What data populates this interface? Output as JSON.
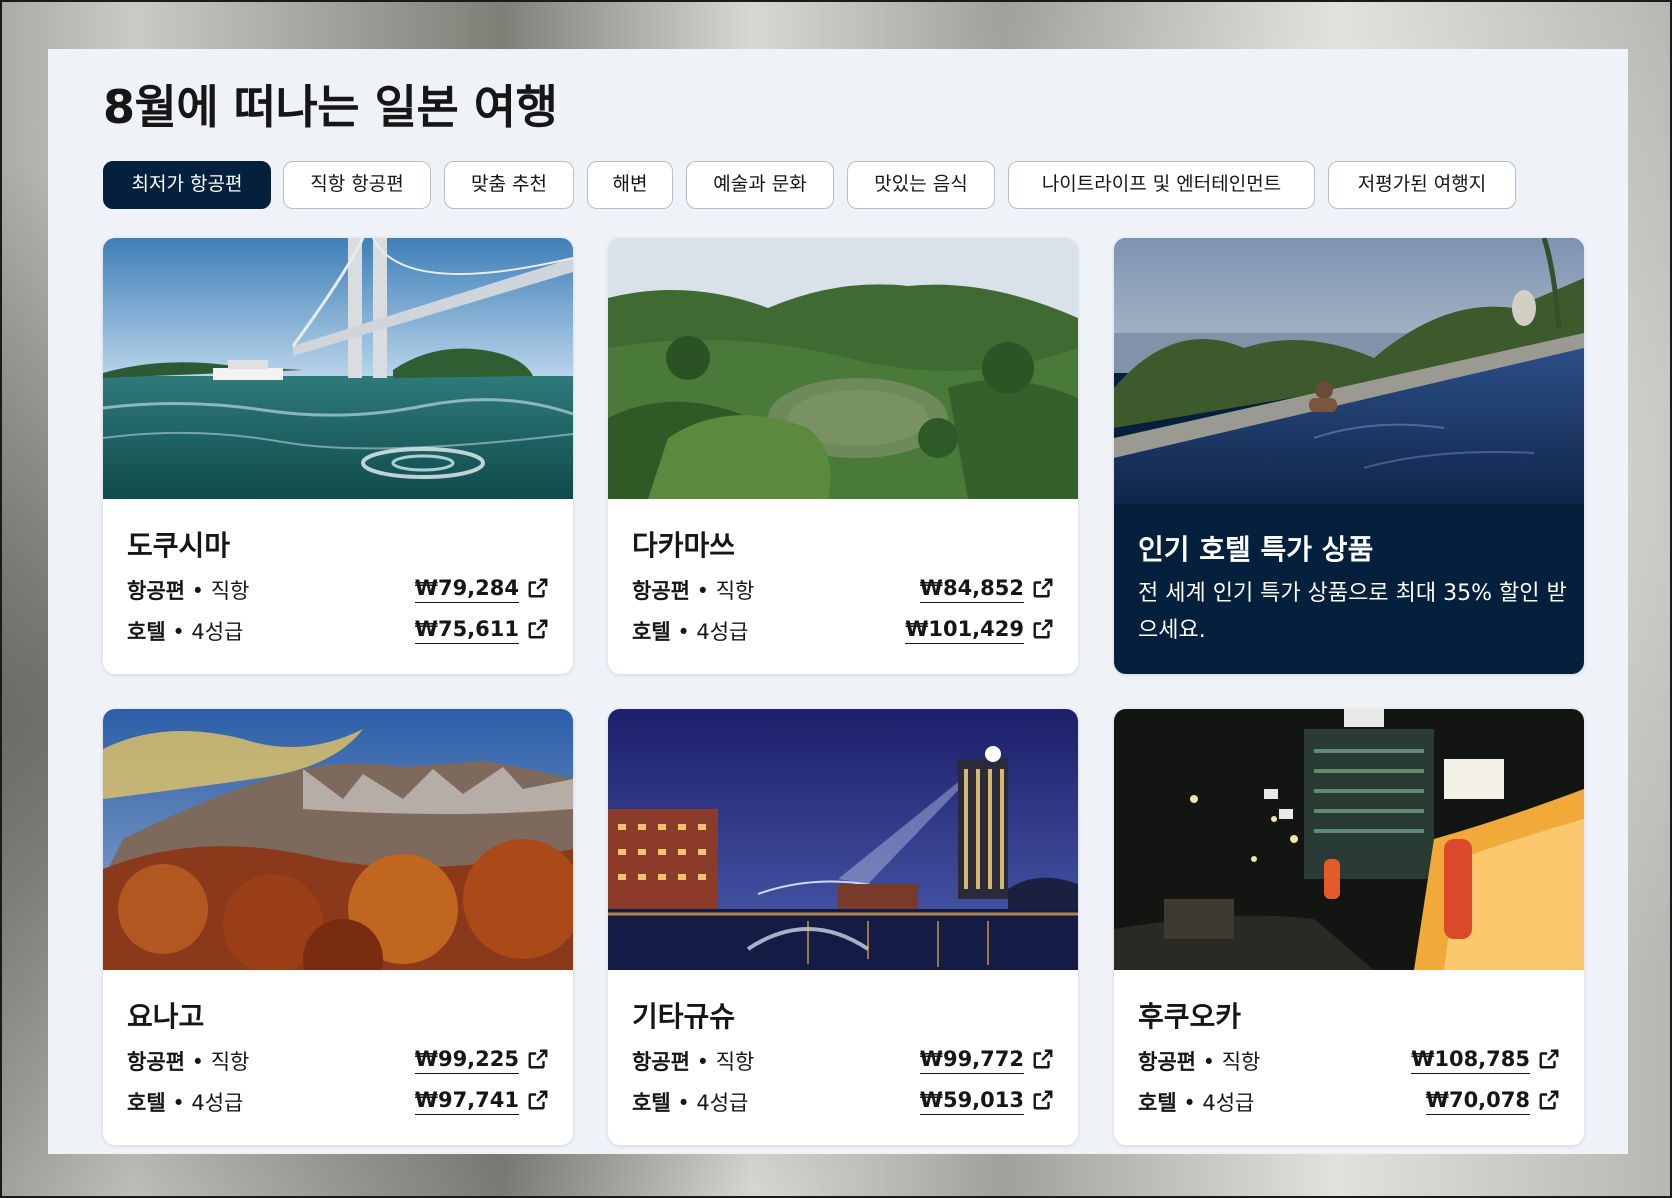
{
  "page": {
    "title": "8월에 떠나는 일본 여행"
  },
  "tabs": [
    {
      "label": "최저가 항공편",
      "active": true
    },
    {
      "label": "직항 항공편",
      "active": false
    },
    {
      "label": "맞춤 추천",
      "active": false
    },
    {
      "label": "해변",
      "active": false
    },
    {
      "label": "예술과 문화",
      "active": false
    },
    {
      "label": "맛있는 음식",
      "active": false
    },
    {
      "label": "나이트라이프 및 엔터테인먼트",
      "active": false
    },
    {
      "label": "저평가된 여행지",
      "active": false
    }
  ],
  "labels": {
    "flight": "항공편",
    "flight_type": " • 직항",
    "hotel": "호텔",
    "hotel_type": " • 4성급"
  },
  "destinations": [
    {
      "name": "도쿠시마",
      "flight_price": "₩79,284",
      "hotel_price": "₩75,611"
    },
    {
      "name": "다카마쓰",
      "flight_price": "₩84,852",
      "hotel_price": "₩101,429"
    },
    {
      "name": "요나고",
      "flight_price": "₩99,225",
      "hotel_price": "₩97,741"
    },
    {
      "name": "기타규슈",
      "flight_price": "₩99,772",
      "hotel_price": "₩59,013"
    },
    {
      "name": "후쿠오카",
      "flight_price": "₩108,785",
      "hotel_price": "₩70,078"
    }
  ],
  "promo": {
    "title": "인기 호텔 특가 상품",
    "description": "전 세계 인기 특가 상품으로 최대 35% 할인 받으세요."
  },
  "icons": {
    "external_link": "external-link-icon"
  },
  "colors": {
    "accent": "#05203c",
    "panel": "#eff3f8",
    "text": "#161616"
  }
}
